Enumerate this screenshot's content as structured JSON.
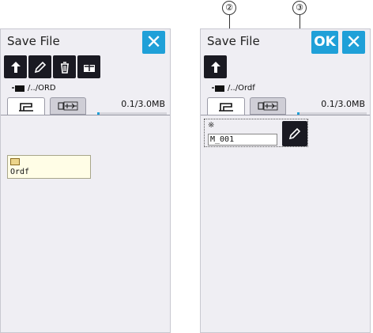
{
  "left_screen": {
    "title": "Save File",
    "close_label": "✕",
    "path": "/../ORD",
    "storage": "0.1/3.0MB",
    "storage_fraction": 0.033,
    "folder": {
      "label": "Ordf"
    }
  },
  "right_screen": {
    "title": "Save File",
    "ok_label": "OK",
    "close_label": "✕",
    "path": "/../Ordf",
    "storage": "0.1/3.0MB",
    "storage_fraction": 0.033,
    "file_icon": "※",
    "file_name": "M_001"
  },
  "callouts": [
    "②",
    "③"
  ],
  "icons": {
    "toolbar": [
      "back-arrow-icon",
      "pencil-icon",
      "trash-icon",
      "new-folder-icon"
    ],
    "tabs": [
      "sewing-machine-icon",
      "usb-icon"
    ]
  },
  "colors": {
    "accent": "#1fa0d8",
    "panel": "#efeef3",
    "tool": "#1a1a22",
    "folder_tile": "#fffde6"
  }
}
